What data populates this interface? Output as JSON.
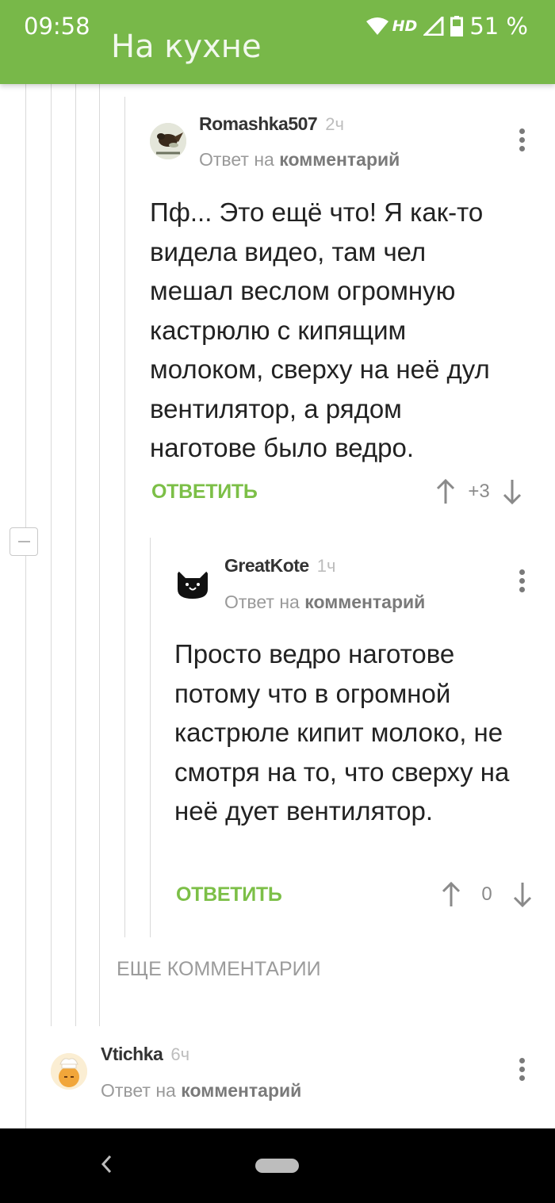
{
  "status_bar": {
    "time": "09:58",
    "network": "HD",
    "battery": "51 %"
  },
  "header": {
    "partial_title": "На кухне"
  },
  "comments": [
    {
      "author": "Romashka507",
      "time": "2ч",
      "reply_prefix": "Ответ на",
      "reply_link": "комментарий",
      "text": "Пф... Это ещё что! Я как-то видела видео, там чел мешал веслом огромную кастрюлю с кипящим молоком, сверху на неё дул вентилятор, а рядом наготове было ведро.",
      "reply_label": "ОТВЕТИТЬ",
      "score": "+3"
    },
    {
      "author": "GreatKote",
      "time": "1ч",
      "reply_prefix": "Ответ на",
      "reply_link": "комментарий",
      "text": "Просто ведро наготове потому что в огромной кастрюле кипит молоко, не смотря на то, что сверху на неё дует вентилятор.",
      "reply_label": "ОТВЕТИТЬ",
      "score": "0"
    },
    {
      "author": "Vtichka",
      "time": "6ч",
      "reply_prefix": "Ответ на",
      "reply_link": "комментарий"
    }
  ],
  "more_comments_label": "ЕЩЕ КОММЕНТАРИИ",
  "colors": {
    "brand_green": "#78b849",
    "reply_green": "#7cbf47"
  }
}
